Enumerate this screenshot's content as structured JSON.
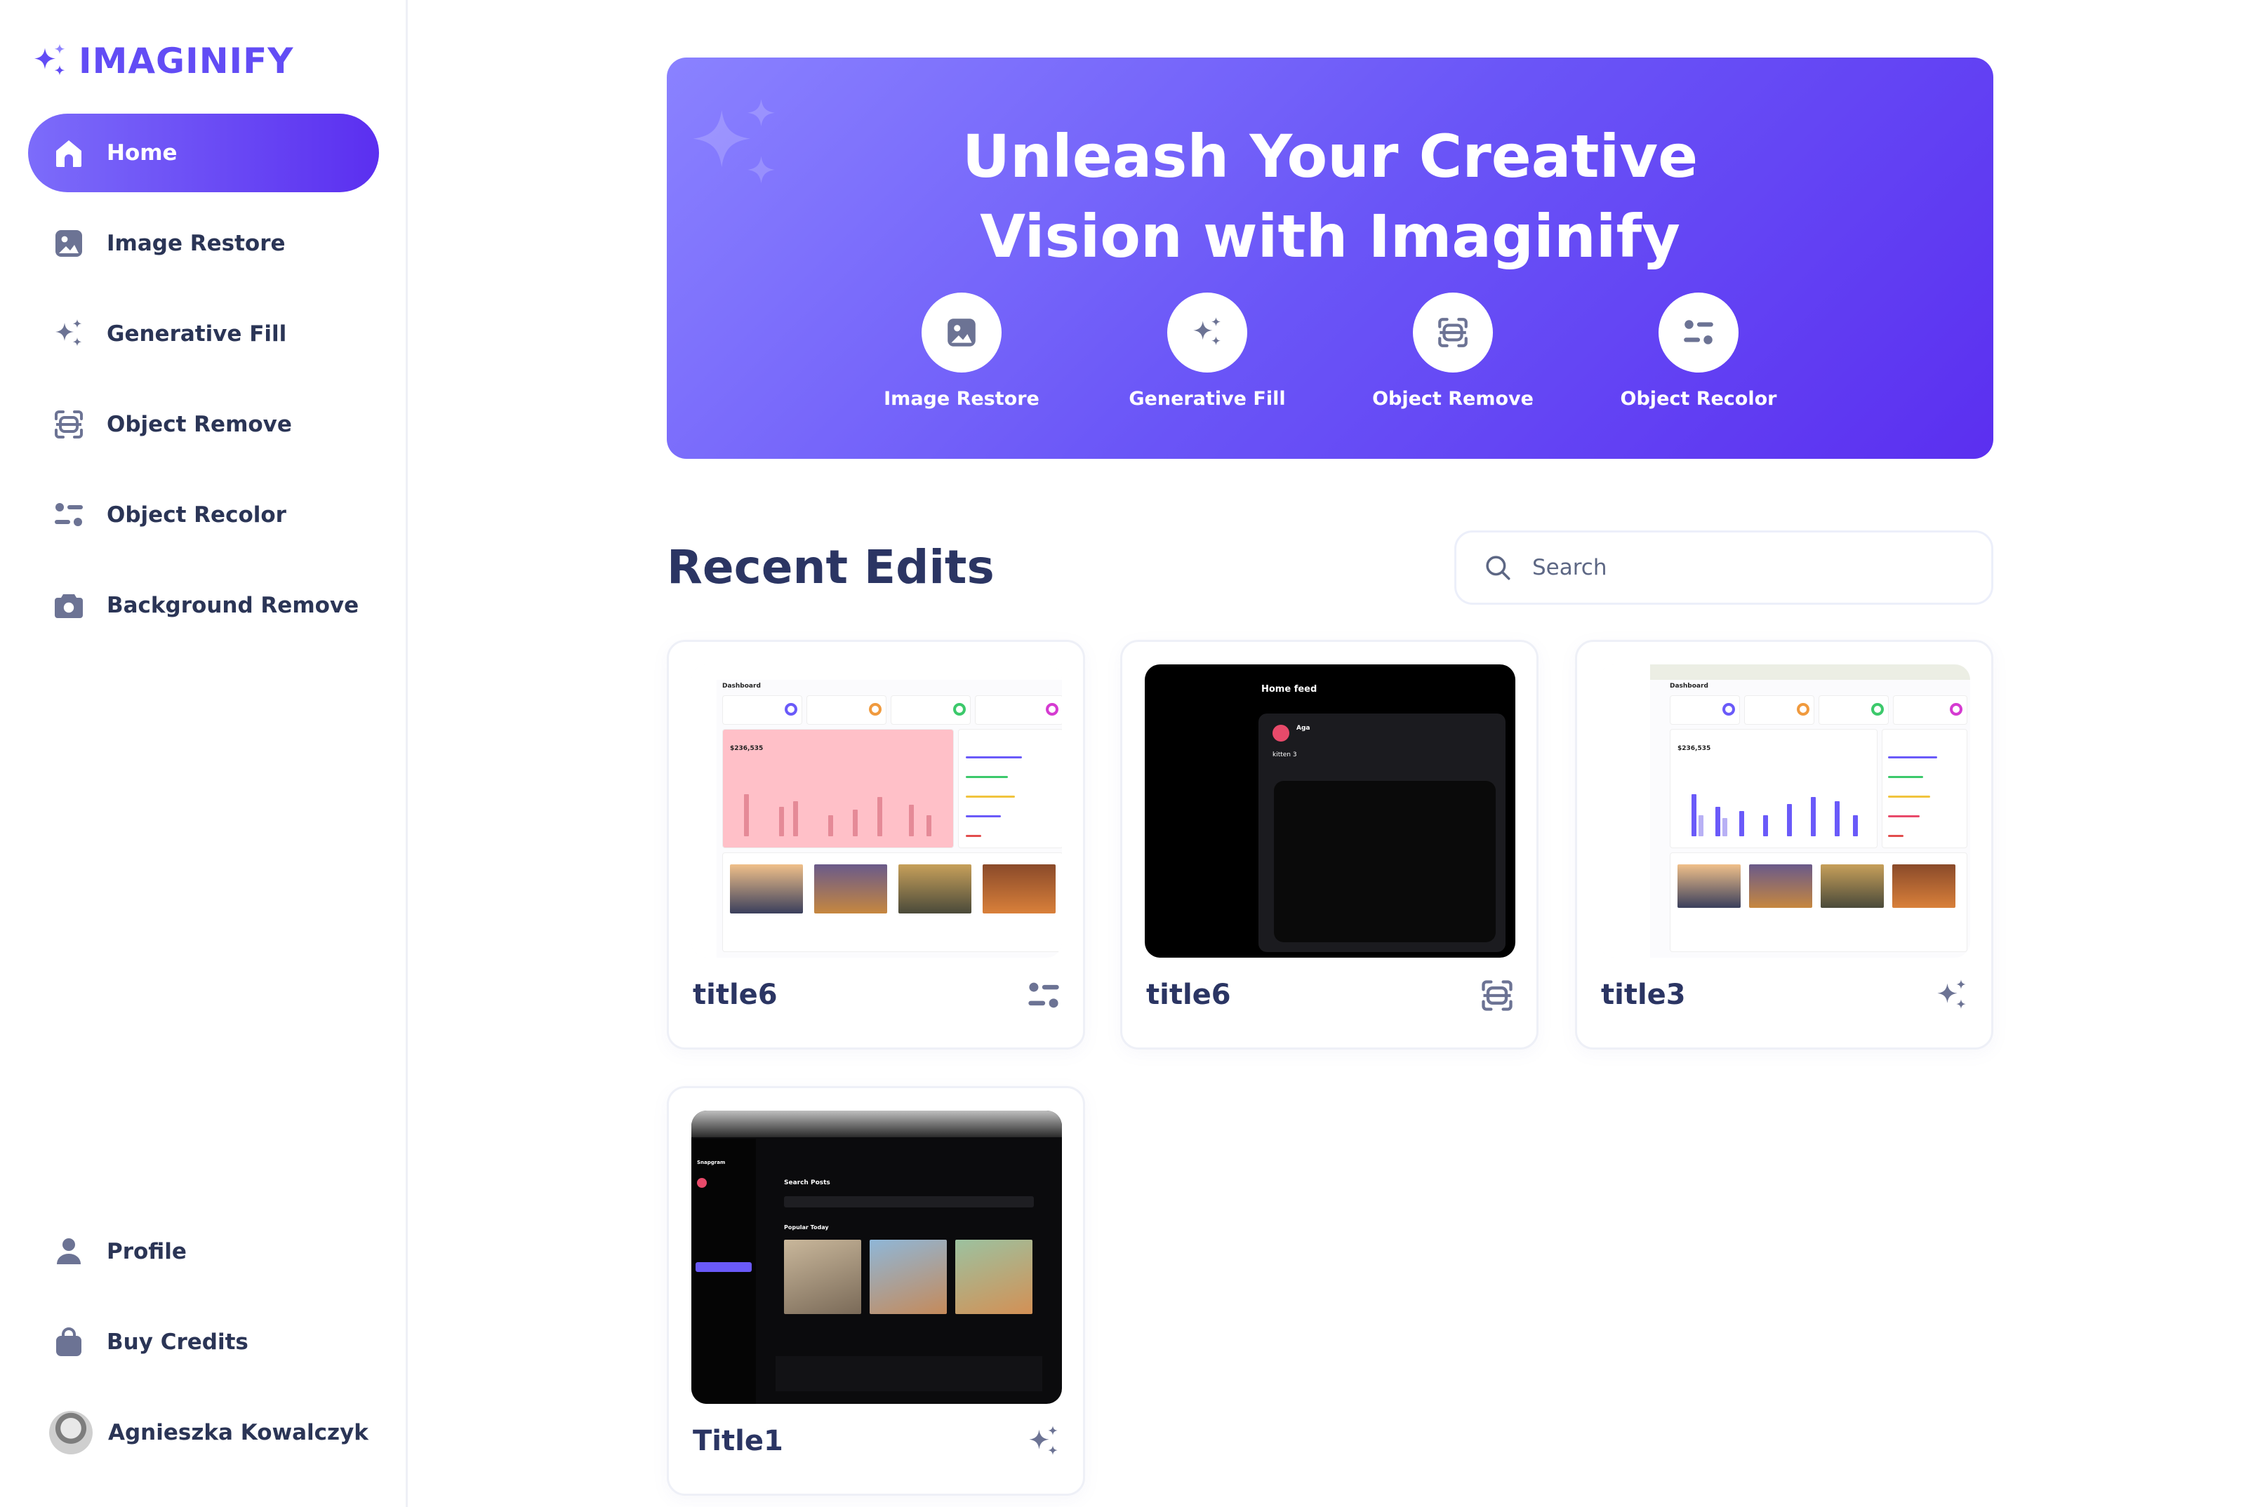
{
  "app": {
    "name": "IMAGINIFY"
  },
  "sidebar": {
    "items": [
      {
        "label": "Home",
        "icon": "home-icon",
        "active": true
      },
      {
        "label": "Image Restore",
        "icon": "image-icon"
      },
      {
        "label": "Generative Fill",
        "icon": "stars-icon"
      },
      {
        "label": "Object Remove",
        "icon": "scan-icon"
      },
      {
        "label": "Object Recolor",
        "icon": "filter-icon"
      },
      {
        "label": "Background Remove",
        "icon": "camera-icon"
      }
    ],
    "bottom": [
      {
        "label": "Profile",
        "icon": "profile-icon"
      },
      {
        "label": "Buy Credits",
        "icon": "bag-icon"
      }
    ],
    "user": {
      "name": "Agnieszka Kowalczyk"
    }
  },
  "banner": {
    "title_line1": "Unleash Your Creative",
    "title_line2": "Vision with Imaginify",
    "tools": [
      {
        "label": "Image Restore",
        "icon": "image-icon"
      },
      {
        "label": "Generative Fill",
        "icon": "stars-icon"
      },
      {
        "label": "Object Remove",
        "icon": "scan-icon"
      },
      {
        "label": "Object Recolor",
        "icon": "filter-icon"
      }
    ]
  },
  "recent": {
    "title": "Recent Edits",
    "search_placeholder": "Search",
    "cards": [
      {
        "title": "title6",
        "icon": "filter-icon",
        "thumbnail": "dashboard-light-pink"
      },
      {
        "title": "title6",
        "icon": "scan-icon",
        "thumbnail": "home-feed-dark"
      },
      {
        "title": "title3",
        "icon": "stars-icon",
        "thumbnail": "dashboard-light"
      },
      {
        "title": "Title1",
        "icon": "stars-icon",
        "thumbnail": "search-posts-dark"
      }
    ]
  },
  "thumbnails": {
    "home_feed": {
      "heading": "Home feed",
      "user": "Aga",
      "post_text": "kitten 3"
    },
    "search_posts": {
      "heading": "Search Posts",
      "section": "Popular Today",
      "app": "Snapgram"
    },
    "dashboard": {
      "heading": "Dashboard",
      "revenue": "$236,535"
    }
  },
  "colors": {
    "accent": "#624cf5",
    "accent_dark": "#5b2ff0",
    "text": "#2b3563",
    "icon": "#6c7394"
  }
}
